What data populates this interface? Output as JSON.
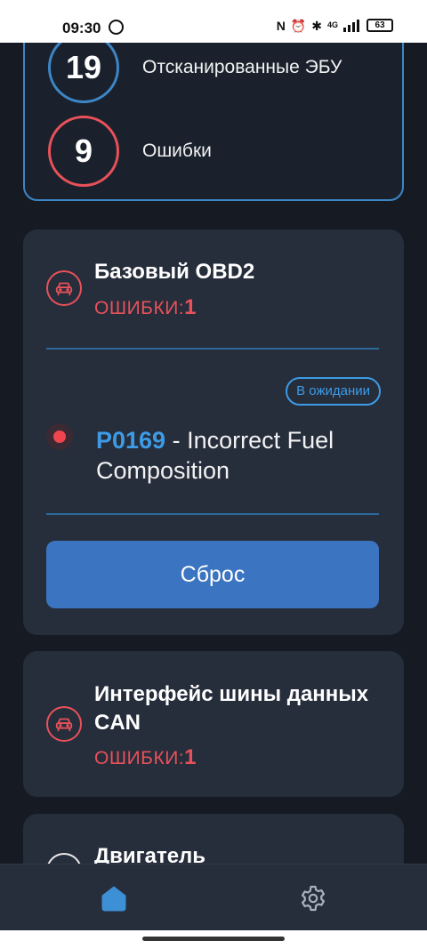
{
  "status_bar": {
    "time": "09:30",
    "nfc": "N",
    "alarm": "⏰",
    "bluetooth": "✱",
    "network": "4G",
    "battery": "63"
  },
  "summary": {
    "scanned_count": "19",
    "scanned_label": "Отсканированные ЭБУ",
    "errors_count": "9",
    "errors_label": "Ошибки"
  },
  "modules": [
    {
      "title": "Базовый OBD2",
      "errors_label": "ОШИБКИ:",
      "errors_count": "1",
      "status_badge": "В ожидании",
      "dtc_code": "P0169",
      "dtc_description": " - Incorrect Fuel Composition",
      "reset_label": "Сброс"
    },
    {
      "title": "Интерфейс шины данных CAN",
      "errors_label": "ОШИБКИ:",
      "errors_count": "1"
    },
    {
      "title": "Двигатель"
    }
  ],
  "colors": {
    "accent_blue": "#3d86c6",
    "error_red": "#e8515a",
    "button_blue": "#3b74c0",
    "card_bg": "#262d3b",
    "page_bg": "#161b23"
  },
  "nav": {
    "items": [
      {
        "icon": "home-icon",
        "active": true
      },
      {
        "icon": "gear-icon",
        "active": false
      }
    ]
  }
}
